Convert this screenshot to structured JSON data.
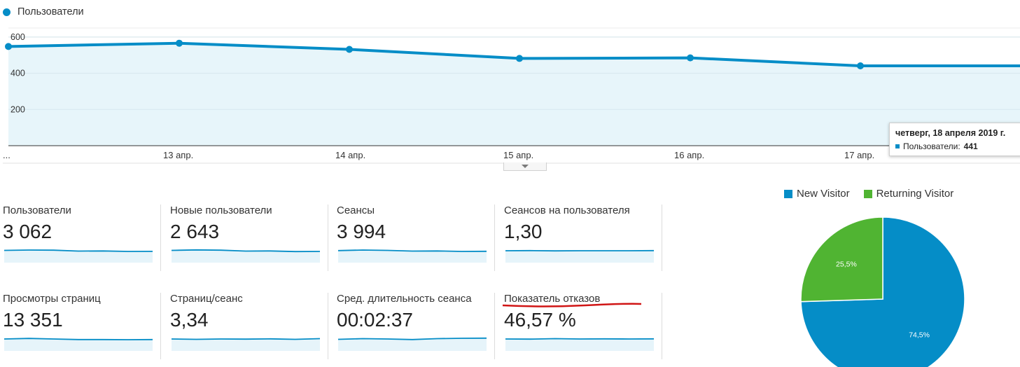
{
  "chart": {
    "legend": "Пользователи",
    "series_color": "#058dc7",
    "y_ticks": [
      "600",
      "400",
      "200"
    ],
    "x_ticks": [
      "...",
      "13 апр.",
      "14 апр.",
      "15 апр.",
      "16 апр.",
      "17 апр."
    ]
  },
  "chart_data": [
    {
      "type": "area",
      "x": [
        "...",
        "13 апр.",
        "14 апр.",
        "15 апр.",
        "16 апр.",
        "17 апр.",
        "18 апр."
      ],
      "series": [
        {
          "name": "Пользователи",
          "values": [
            548,
            566,
            532,
            482,
            485,
            441,
            441
          ]
        }
      ],
      "ylim": [
        0,
        650
      ],
      "y_ticks": [
        200,
        400,
        600
      ],
      "grid": true
    },
    {
      "type": "pie",
      "series": [
        {
          "name": "New Visitor",
          "value": 74.5,
          "label": "74,5%",
          "color": "#058dc7"
        },
        {
          "name": "Returning Visitor",
          "value": 25.5,
          "label": "25,5%",
          "color": "#50b432"
        }
      ]
    }
  ],
  "tooltip": {
    "date": "четверг, 18 апреля 2019 г.",
    "series_label": "Пользователи:",
    "value": "441"
  },
  "metrics": [
    {
      "label": "Пользователи",
      "value": "3 062",
      "spark": [
        0.55,
        0.6,
        0.58,
        0.45,
        0.47,
        0.4,
        0.41
      ]
    },
    {
      "label": "Новые пользователи",
      "value": "2 643",
      "spark": [
        0.55,
        0.62,
        0.58,
        0.45,
        0.47,
        0.38,
        0.4
      ]
    },
    {
      "label": "Сеансы",
      "value": "3 994",
      "spark": [
        0.52,
        0.6,
        0.55,
        0.45,
        0.47,
        0.4,
        0.42
      ]
    },
    {
      "label": "Сеансов на пользователя",
      "value": "1,30",
      "spark": [
        0.5,
        0.52,
        0.48,
        0.5,
        0.5,
        0.5,
        0.52
      ]
    },
    {
      "label": "Просмотры страниц",
      "value": "13 351",
      "spark": [
        0.5,
        0.58,
        0.5,
        0.42,
        0.42,
        0.4,
        0.42
      ]
    },
    {
      "label": "Страниц/сеанс",
      "value": "3,34",
      "spark": [
        0.5,
        0.45,
        0.5,
        0.48,
        0.52,
        0.45,
        0.55
      ]
    },
    {
      "label": "Сред. длительность сеанса",
      "value": "00:02:37",
      "spark": [
        0.45,
        0.55,
        0.5,
        0.42,
        0.55,
        0.6,
        0.62
      ]
    },
    {
      "label": "Показатель отказов",
      "value": "46,57 %",
      "spark": [
        0.5,
        0.48,
        0.55,
        0.5,
        0.52,
        0.5,
        0.52
      ]
    }
  ]
}
